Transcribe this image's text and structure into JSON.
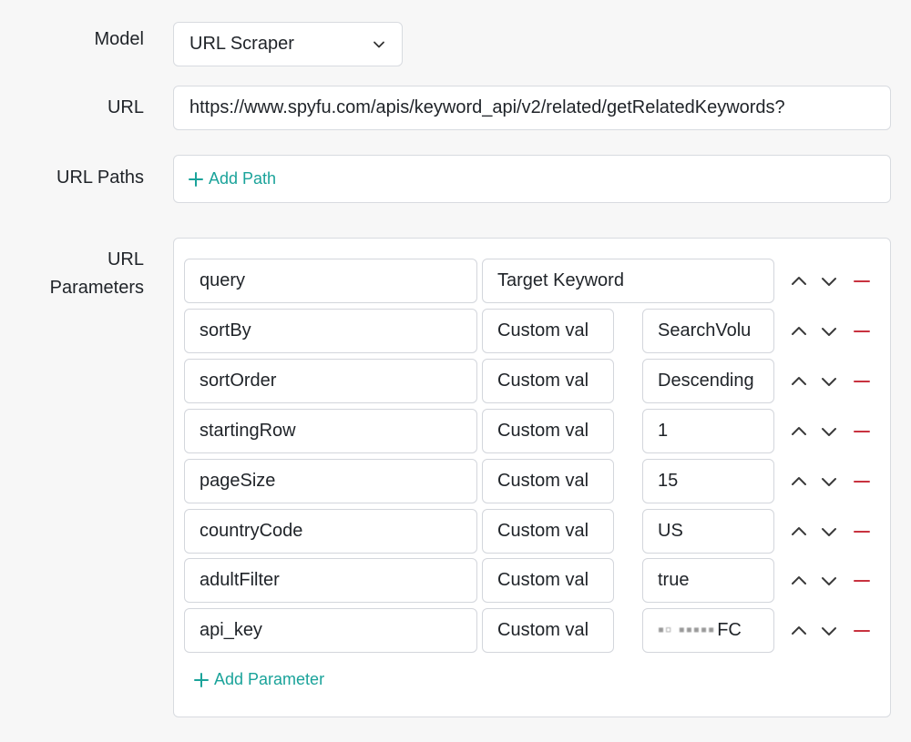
{
  "form": {
    "model_label": "Model",
    "model_value": "URL Scraper",
    "url_label": "URL",
    "url_value": "https://www.spyfu.com/apis/keyword_api/v2/related/getRelatedKeywords?",
    "paths_label": "URL Paths",
    "add_path_label": "Add Path",
    "params_label_line1": "URL",
    "params_label_line2": "Parameters",
    "add_param_label": "Add Parameter"
  },
  "params": [
    {
      "name": "query",
      "source": "Target Keyword",
      "value": ""
    },
    {
      "name": "sortBy",
      "source": "Custom val",
      "value": "SearchVolu"
    },
    {
      "name": "sortOrder",
      "source": "Custom val",
      "value": "Descending"
    },
    {
      "name": "startingRow",
      "source": "Custom val",
      "value": "1"
    },
    {
      "name": "pageSize",
      "source": "Custom val",
      "value": "15"
    },
    {
      "name": "countryCode",
      "source": "Custom val",
      "value": "US"
    },
    {
      "name": "adultFilter",
      "source": "Custom val",
      "value": "true"
    },
    {
      "name": "api_key",
      "source": "Custom val",
      "value": "FC"
    }
  ],
  "icons": {
    "chevron": "chevron-down-icon",
    "up": "arrow-up-icon",
    "down": "arrow-down-icon",
    "remove": "remove-icon",
    "add": "plus-icon"
  },
  "colors": {
    "accent": "#1aa39a",
    "danger": "#c8323f"
  }
}
